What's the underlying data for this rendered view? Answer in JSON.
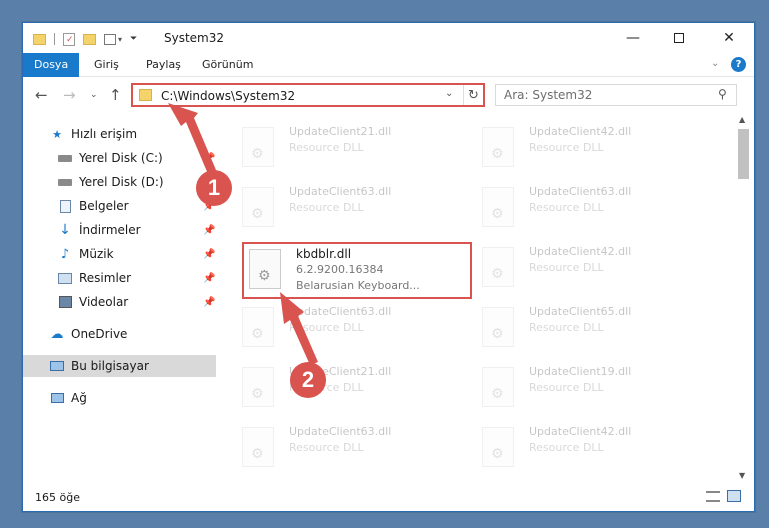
{
  "window": {
    "title": "System32",
    "minimize_icon": "minimize-icon",
    "maximize_icon": "maximize-icon",
    "close_icon": "close-icon"
  },
  "ribbon": {
    "tabs": [
      {
        "label": "Dosya",
        "active": true
      },
      {
        "label": "Giriş",
        "active": false
      },
      {
        "label": "Paylaş",
        "active": false
      },
      {
        "label": "Görünüm",
        "active": false
      }
    ],
    "help_icon": "?"
  },
  "address": {
    "path": "C:\\Windows\\System32",
    "search_placeholder": "Ara: System32"
  },
  "sidebar": {
    "items": [
      {
        "label": "Hızlı erişim",
        "icon": "star-icon"
      },
      {
        "label": "Yerel Disk (C:)",
        "icon": "drive-icon",
        "pinned": true
      },
      {
        "label": "Yerel Disk (D:)",
        "icon": "drive-icon",
        "pinned": true
      },
      {
        "label": "Belgeler",
        "icon": "documents-icon",
        "pinned": true
      },
      {
        "label": "İndirmeler",
        "icon": "download-icon",
        "pinned": true
      },
      {
        "label": "Müzik",
        "icon": "music-icon",
        "pinned": true
      },
      {
        "label": "Resimler",
        "icon": "pictures-icon",
        "pinned": true
      },
      {
        "label": "Videolar",
        "icon": "video-icon",
        "pinned": true
      },
      {
        "label": "OneDrive",
        "icon": "cloud-icon"
      },
      {
        "label": "Bu bilgisayar",
        "icon": "computer-icon",
        "selected": true
      },
      {
        "label": "Ağ",
        "icon": "network-icon"
      }
    ]
  },
  "files": {
    "highlighted": {
      "name": "kbdblr.dll",
      "version": "6.2.9200.16384",
      "description": "Belarusian Keyboard..."
    },
    "faded": [
      {
        "name": "UpdateClient21.dll",
        "type": "Resource DLL"
      },
      {
        "name": "UpdateClient42.dll",
        "type": "Resource DLL"
      },
      {
        "name": "UpdateClient63.dll",
        "type": "Resource DLL"
      },
      {
        "name": "UpdateClient63.dll",
        "type": "Resource DLL"
      },
      {
        "name": "UpdateClient42.dll",
        "type": "Resource DLL"
      },
      {
        "name": "UpdateClient63.dll",
        "type": "Resource DLL"
      },
      {
        "name": "UpdateClient65.dll",
        "type": "Resource DLL"
      },
      {
        "name": "UpdateClient21.dll",
        "type": "Resource DLL"
      },
      {
        "name": "UpdateClient19.dll",
        "type": "Resource DLL"
      },
      {
        "name": "UpdateClient63.dll",
        "type": "Resource DLL"
      },
      {
        "name": "UpdateClient42.dll",
        "type": "Resource DLL"
      }
    ]
  },
  "status": {
    "count": "165 öğe"
  },
  "callouts": [
    "1",
    "2"
  ],
  "colors": {
    "accent": "#1979ca",
    "highlight": "#d9534f"
  }
}
